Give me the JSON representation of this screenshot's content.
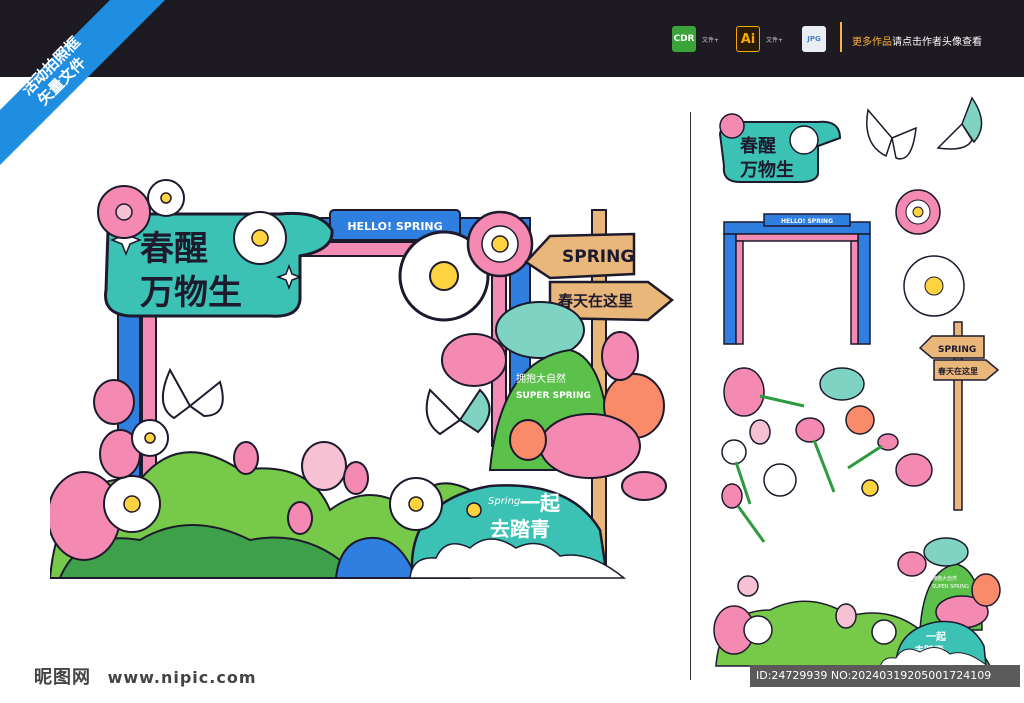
{
  "ribbon": {
    "line1": "活动拍照框",
    "line2": "矢量文件"
  },
  "formats": [
    {
      "icon": "CDR",
      "label": "文件+",
      "color": "#3aa33a"
    },
    {
      "icon": "Ai",
      "label": "文件+",
      "color": "#2a1b05"
    },
    {
      "icon": "JPG",
      "label": "",
      "color": "#7aa7d9"
    }
  ],
  "more": {
    "highlight": "更多作品",
    "text": "请点击作者头像查看"
  },
  "frame": {
    "title_line1": "春醒",
    "title_line2": "万物生",
    "banner": "HELLO! SPRING",
    "sign1": "SPRING",
    "sign2": "春天在这里",
    "hill_cn": "拥抱大自然",
    "hill_en": "SUPER SPRING",
    "cloud_spring": "Spring",
    "cloud_line1": "一起",
    "cloud_line2": "去踏青"
  },
  "elements": {
    "title_line1": "春醒",
    "title_line2": "万物生",
    "arch_banner": "HELLO! SPRING",
    "sign1": "SPRING",
    "sign2": "春天在这里",
    "mini_hill_cn": "拥抱大自然",
    "mini_hill_en": "SUPER SPRING",
    "mini_cloud_line1": "一起",
    "mini_cloud_line2": "去踏青"
  },
  "footer": {
    "site_logo": "昵图网",
    "site_url": "www.nipic.com",
    "id_text": "ID:24729939 NO:20240319205001724109"
  }
}
